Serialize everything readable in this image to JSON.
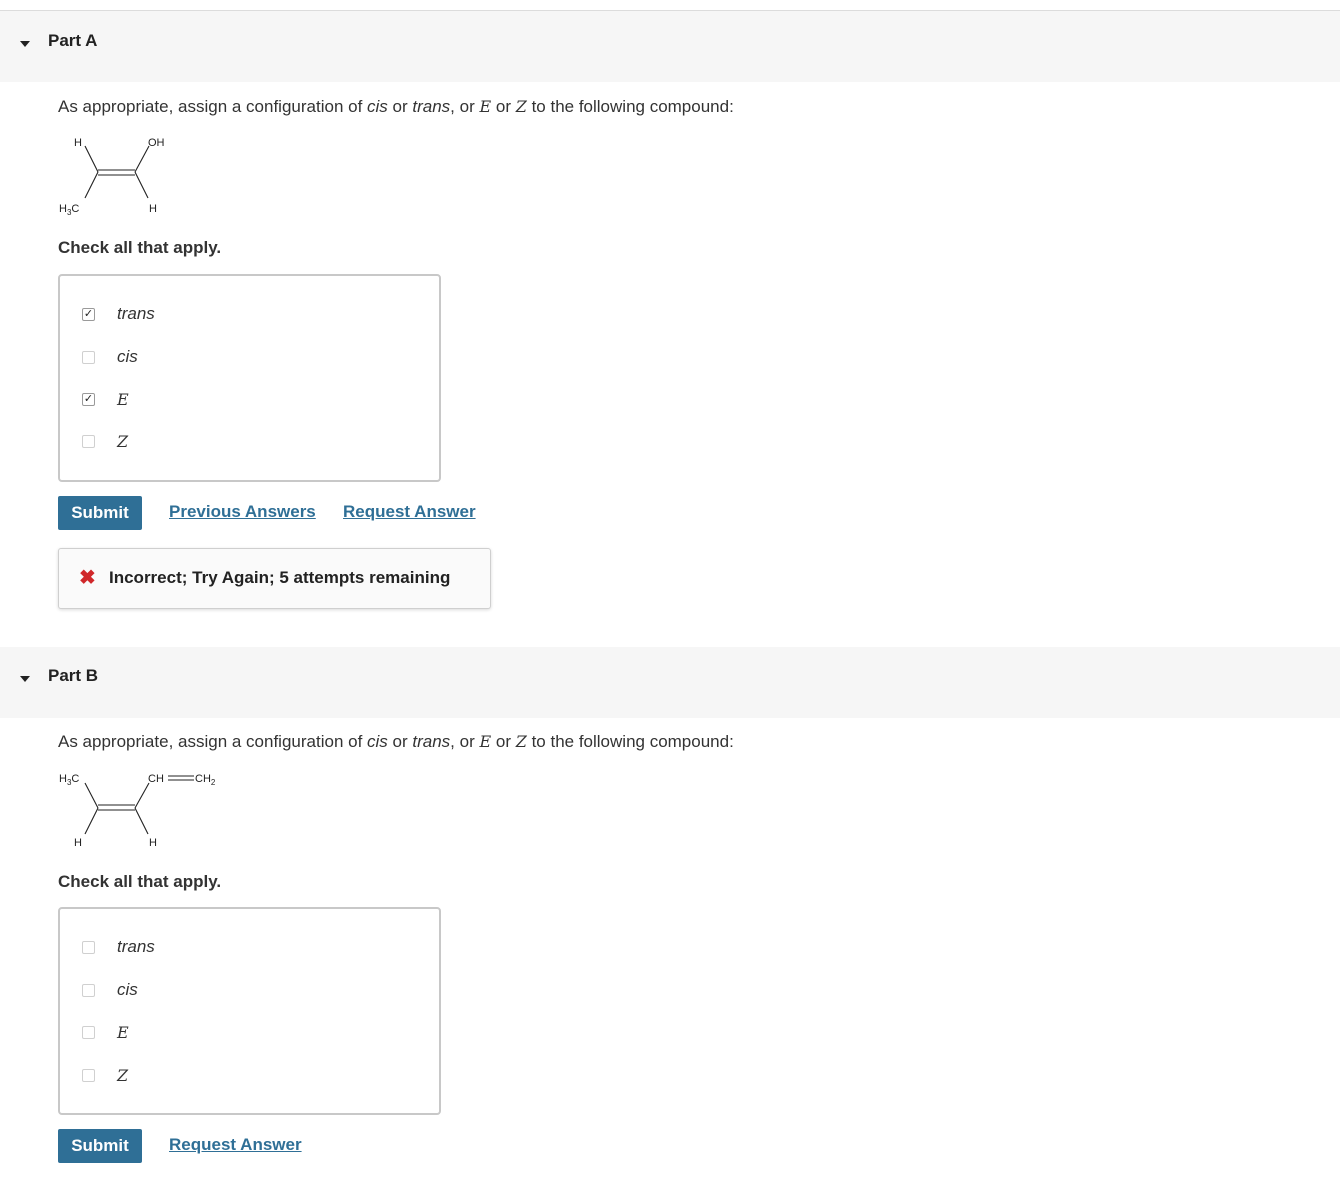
{
  "partA": {
    "title": "Part A",
    "prompt": {
      "pre": "As appropriate, assign a configuration of ",
      "cis": "cis",
      "or1": " or ",
      "trans": "trans",
      "or2": ", or ",
      "E": "E",
      "or3": " or ",
      "Z": "Z",
      "post": " to the following compound:"
    },
    "molecule": {
      "top_left": "H",
      "top_right": "OH",
      "bottom_left_main": "H",
      "bottom_left_sub": "3",
      "bottom_left_end": "C",
      "bottom_right": "H"
    },
    "instruction": "Check all that apply.",
    "choices": [
      {
        "label": "trans",
        "checked": true,
        "mark": "✓"
      },
      {
        "label": "cis",
        "checked": false,
        "mark": ""
      },
      {
        "label": "E",
        "checked": true,
        "mark": "✓"
      },
      {
        "label": "Z",
        "checked": false,
        "mark": ""
      }
    ],
    "submit_label": "Submit",
    "previous_answers_label": "Previous Answers",
    "request_answer_label": "Request Answer",
    "feedback": {
      "icon": "close-x-icon",
      "icon_glyph": "✖",
      "message": "Incorrect; Try Again; 5 attempts remaining",
      "color": "#d0272a"
    }
  },
  "partB": {
    "title": "Part B",
    "prompt": {
      "pre": "As appropriate, assign a configuration of ",
      "cis": "cis",
      "or1": " or ",
      "trans": "trans",
      "or2": ", or ",
      "E": "E",
      "or3": " or ",
      "Z": "Z",
      "post": " to the following compound:"
    },
    "molecule": {
      "top_left_main": "H",
      "top_left_sub": "3",
      "top_left_end": "C",
      "top_right_ch": "CH",
      "top_right_ch2": "CH",
      "top_right_sub": "2",
      "bottom_left": "H",
      "bottom_right": "H"
    },
    "instruction": "Check all that apply.",
    "choices": [
      {
        "label": "trans",
        "checked": false,
        "mark": ""
      },
      {
        "label": "cis",
        "checked": false,
        "mark": ""
      },
      {
        "label": "E",
        "checked": false,
        "mark": ""
      },
      {
        "label": "Z",
        "checked": false,
        "mark": ""
      }
    ],
    "submit_label": "Submit",
    "request_answer_label": "Request Answer"
  },
  "colors": {
    "accent": "#2f6f96",
    "header_bg": "#f6f6f6",
    "error": "#d0272a"
  }
}
